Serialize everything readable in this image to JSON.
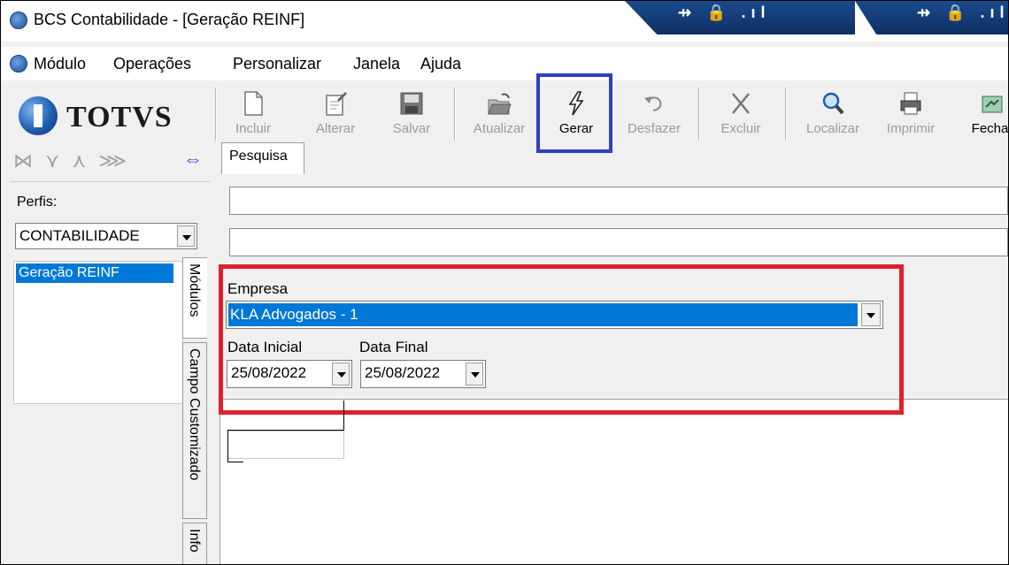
{
  "window": {
    "title": "BCS Contabilidade - [Geração REINF]"
  },
  "connection": {
    "icons_1": "⇸ 🔒 .ıl",
    "icons_2": "⇸ 🔒 .ıl"
  },
  "menu": {
    "items": [
      "Módulo",
      "Operações",
      "Personalizar",
      "Janela",
      "Ajuda"
    ]
  },
  "logo": {
    "text": "TOTVS"
  },
  "toolbar": {
    "incluir": "Incluir",
    "alterar": "Alterar",
    "salvar": "Salvar",
    "atualizar": "Atualizar",
    "gerar": "Gerar",
    "desfazer": "Desfazer",
    "excluir": "Excluir",
    "localizar": "Localizar",
    "imprimir": "Imprimir",
    "fechar": "Fechar"
  },
  "nav": {
    "glyphs": "⋈ ⋎ ⋏ ⋙",
    "swap": "⇔"
  },
  "perfis": {
    "label": "Perfis:",
    "value": "CONTABILIDADE"
  },
  "modules": {
    "selected": "Geração REINF"
  },
  "side_tabs": {
    "modulos": "Módulos",
    "campo": "Campo Customizado",
    "info": "Info"
  },
  "tab": {
    "pesquisa": "Pesquisa"
  },
  "form": {
    "empresa_label": "Empresa",
    "empresa_value": "KLA Advogados - 1",
    "data_inicial_label": "Data Inicial",
    "data_inicial_value": "25/08/2022",
    "data_final_label": "Data Final",
    "data_final_value": "25/08/2022"
  },
  "colors": {
    "highlight_red": "#e0202a",
    "highlight_blue": "#2f3fbf",
    "selection": "#0078d7"
  }
}
